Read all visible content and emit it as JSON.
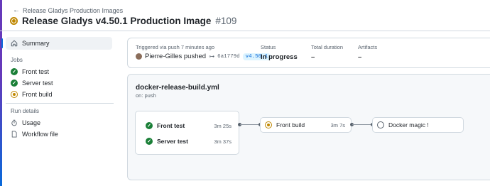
{
  "back_link": {
    "label": "Release Gladys Production Images"
  },
  "header": {
    "title": "Release Gladys v4.50.1 Production Image",
    "run_number": "#109"
  },
  "sidebar": {
    "summary_label": "Summary",
    "jobs_heading": "Jobs",
    "jobs": [
      {
        "label": "Front test",
        "status": "success"
      },
      {
        "label": "Server test",
        "status": "success"
      },
      {
        "label": "Front build",
        "status": "in_progress"
      }
    ],
    "run_details_heading": "Run details",
    "details": [
      {
        "label": "Usage",
        "icon": "stopwatch-icon"
      },
      {
        "label": "Workflow file",
        "icon": "file-icon"
      }
    ]
  },
  "summary": {
    "trigger_label": "Triggered via push 7 minutes ago",
    "actor": "Pierre-Gilles pushed",
    "commit": "6a1779d",
    "tag": "v4.50.1",
    "status_label": "Status",
    "status_value": "In progress",
    "duration_label": "Total duration",
    "duration_value": "–",
    "artifacts_label": "Artifacts",
    "artifacts_value": "–"
  },
  "graph": {
    "workflow_file": "docker-release-build.yml",
    "trigger": "on: push",
    "group1": [
      {
        "name": "Front test",
        "time": "3m 25s",
        "status": "success"
      },
      {
        "name": "Server test",
        "time": "3m 37s",
        "status": "success"
      }
    ],
    "group2": {
      "name": "Front build",
      "time": "3m 7s",
      "status": "in_progress"
    },
    "group3": {
      "name": "Docker magic !",
      "status": "queued"
    }
  },
  "colors": {
    "success": "#1a7f37",
    "in_progress": "#bf8700",
    "accent": "#0969da",
    "border": "#d1d9e0"
  }
}
